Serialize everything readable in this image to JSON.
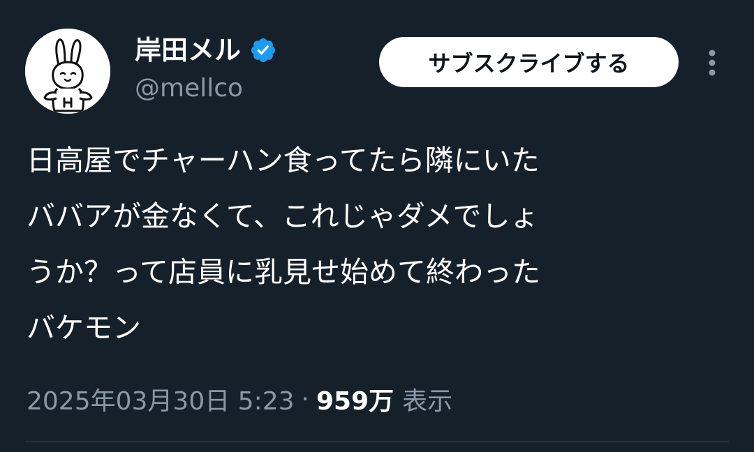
{
  "author": {
    "display_name": "岸田メル",
    "handle": "@mellco",
    "verified_icon": "verified-badge-icon",
    "avatar": "bunny-mascot-avatar"
  },
  "actions": {
    "subscribe_label": "サブスクライブする",
    "more_icon": "more-vertical-icon"
  },
  "post": {
    "lines": [
      "日高屋でチャーハン食ってたら隣にいた",
      "ババアが金なくて、これじゃダメでしょ",
      "うか？って店員に乳見せ始めて終わった",
      "バケモン"
    ]
  },
  "meta": {
    "timestamp": "2025年03月30日 5:23",
    "separator": "·",
    "views_count": "959万",
    "views_label": "表示"
  },
  "colors": {
    "background": "#15202b",
    "text_primary": "#ffffff",
    "text_secondary": "#8b98a5",
    "verified_blue": "#1d9bf0",
    "divider": "#38444d"
  }
}
